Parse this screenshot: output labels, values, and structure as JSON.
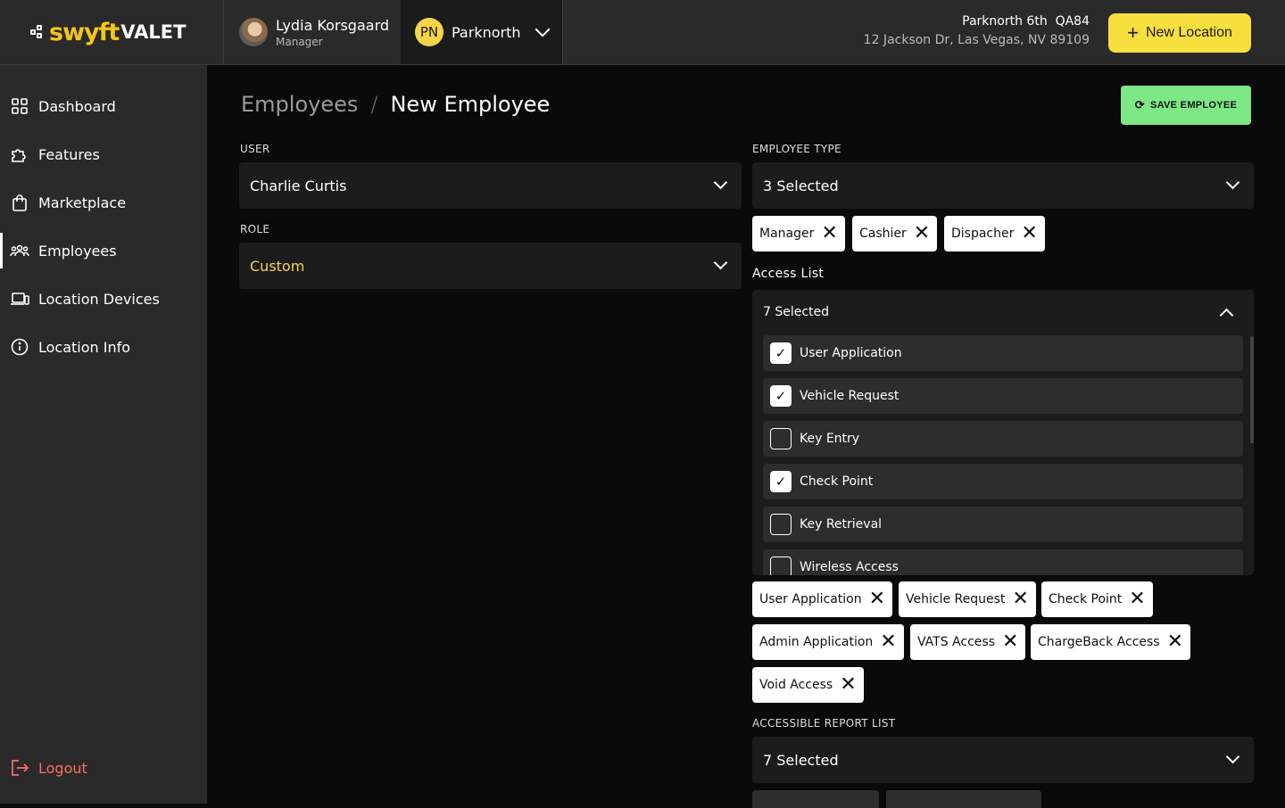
{
  "brand": {
    "part1": "swyft",
    "part2": "VALET"
  },
  "user": {
    "name": "Lydia Korsgaard",
    "role": "Manager"
  },
  "location": {
    "initials": "PN",
    "name": "Parknorth",
    "title": "Parknorth 6th  QA84",
    "address": "12 Jackson Dr, Las Vegas, NV 89109"
  },
  "new_location_label": "New Location",
  "sidebar": {
    "items": [
      {
        "label": "Dashboard",
        "icon": "grid-icon"
      },
      {
        "label": "Features",
        "icon": "puzzle-icon"
      },
      {
        "label": "Marketplace",
        "icon": "bag-icon"
      },
      {
        "label": "Employees",
        "icon": "people-icon"
      },
      {
        "label": "Location Devices",
        "icon": "devices-icon"
      },
      {
        "label": "Location Info",
        "icon": "info-icon"
      }
    ],
    "logout": "Logout"
  },
  "breadcrumb": {
    "parent": "Employees",
    "separator": "/",
    "current": "New Employee"
  },
  "save_label": "SAVE EMPLOYEE",
  "form": {
    "user_label": "USER",
    "user_value": "Charlie Curtis",
    "role_label": "ROLE",
    "role_value": "Custom",
    "employee_type_label": "EMPLOYEE TYPE",
    "employee_type_value": "3 Selected",
    "employee_type_chips": [
      "Manager",
      "Cashier",
      "Dispacher"
    ],
    "access_label": "Access List",
    "access_value": "7 Selected",
    "access_options": [
      {
        "label": "User Application",
        "checked": true
      },
      {
        "label": "Vehicle Request",
        "checked": true
      },
      {
        "label": "Key Entry",
        "checked": false
      },
      {
        "label": "Check Point",
        "checked": true
      },
      {
        "label": "Key Retrieval",
        "checked": false
      },
      {
        "label": "Wireless Access",
        "checked": false
      }
    ],
    "access_chips": [
      "User Application",
      "Vehicle Request",
      "Check Point",
      "Admin Application",
      "VATS Access",
      "ChargeBack Access",
      "Void Access"
    ],
    "report_label": "ACCESSIBLE REPORT LIST",
    "report_value": "7 Selected"
  },
  "colors": {
    "accent": "#f7df3e",
    "save": "#7ee887",
    "logout": "#ff6b5e",
    "role_value": "#f5d547"
  }
}
